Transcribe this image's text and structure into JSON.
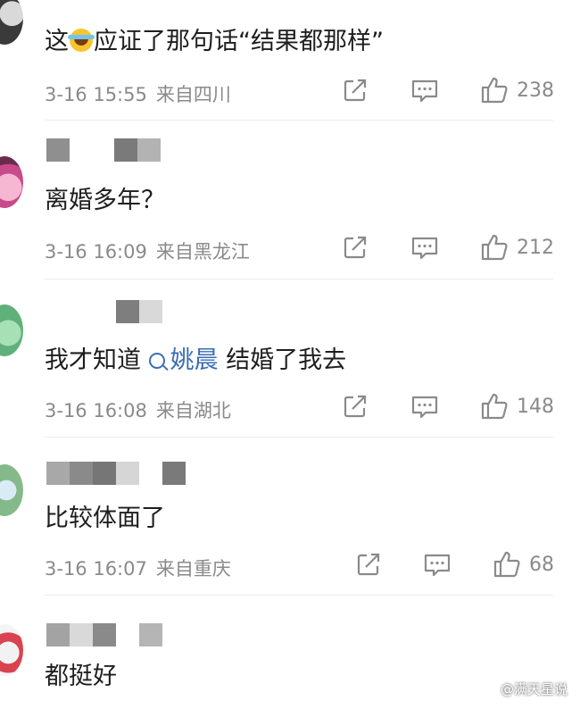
{
  "comments": [
    {
      "text_before": "这",
      "text_after": "应证了那句话“结果都那样”",
      "emoji": "laugh-cry-emoji",
      "time": "3-16 15:55",
      "location": "来自四川",
      "likes": "238"
    },
    {
      "text": "离婚多年？",
      "time": "3-16 16:09",
      "location": "来自黑龙江",
      "likes": "212"
    },
    {
      "text_before": "我才知道",
      "topic": "姚晨",
      "text_after": "结婚了我去",
      "time": "3-16 16:08",
      "location": "来自湖北",
      "likes": "148"
    },
    {
      "text": "比较体面了",
      "time": "3-16 16:07",
      "location": "来自重庆",
      "likes": "68"
    },
    {
      "text": "都挺好"
    }
  ],
  "watermark": "@满天星说",
  "icons": {
    "forward": "forward-icon",
    "comment": "comment-icon",
    "like": "thumbs-up-icon"
  },
  "colors": {
    "topic_link": "#3b6db5",
    "meta_gray": "#8a8a8a"
  }
}
